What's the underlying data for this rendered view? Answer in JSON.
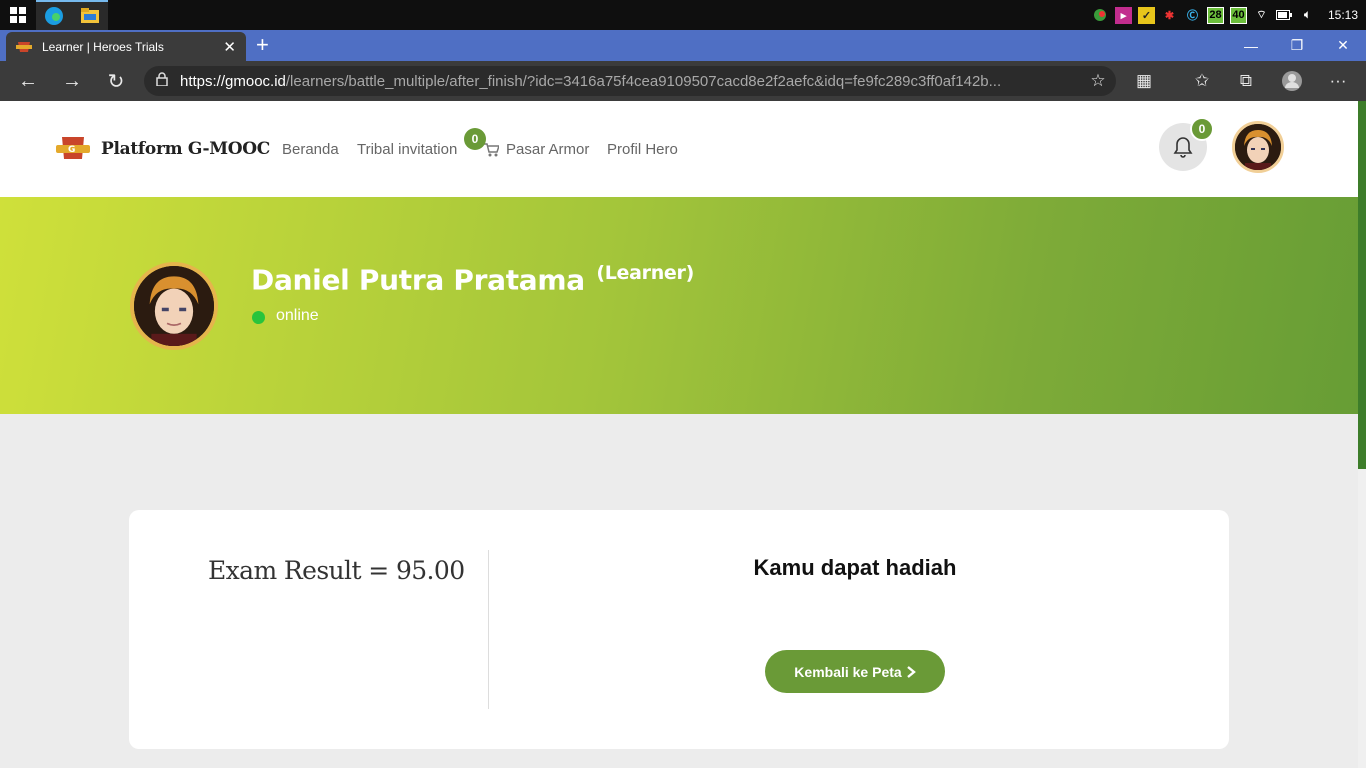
{
  "browser": {
    "tab_title": "Learner | Heroes Trials",
    "tab_close": "✕",
    "new_tab": "+",
    "url_host": "https://gmooc.id",
    "url_path": "/learners/battle_multiple/after_finish/?idc=3416a75f4cea9109507cacd8e2f2aefc&idq=fe9fc289c3ff0af142b..."
  },
  "taskbar": {
    "clock": "15:13",
    "tray_badges": [
      "28",
      "40"
    ]
  },
  "site": {
    "brand": "Platform G-MOOC",
    "nav": {
      "home": "Beranda",
      "tribal": "Tribal invitation",
      "tribal_badge": "0",
      "armor": "Pasar Armor",
      "profile": "Profil Hero"
    },
    "notif_count": "0"
  },
  "profile": {
    "name": "Daniel Putra Pratama",
    "role": "(Learner)",
    "status": "online"
  },
  "result": {
    "score_text": "Exam Result = 95.00",
    "reward_text": "Kamu dapat hadiah",
    "back_button": "Kembali ke Peta"
  },
  "colors": {
    "accent": "#6a9a37",
    "banner_start": "#cfe03a",
    "banner_end": "#679d35",
    "online": "#28c43c"
  }
}
